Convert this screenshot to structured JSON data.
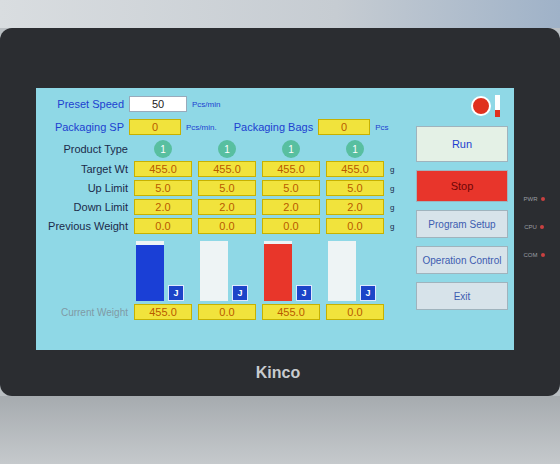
{
  "device": {
    "brand": "Kinco",
    "leds": [
      "PWR",
      "CPU",
      "COM"
    ]
  },
  "preset_speed": {
    "label": "Preset Speed",
    "value": "50",
    "unit": "Pcs/min"
  },
  "packaging_sp": {
    "label": "Packaging SP",
    "value": "0",
    "unit": "Pcs/min."
  },
  "packaging_bags": {
    "label": "Packaging Bags",
    "value": "0",
    "unit": "Pcs"
  },
  "status_lamp": {
    "on": true,
    "color": "#e0301e",
    "level": 0.3
  },
  "product_type": {
    "label": "Product Type",
    "values": [
      "1",
      "1",
      "1",
      "1"
    ]
  },
  "rows": [
    {
      "label": "Target Wt",
      "values": [
        "455.0",
        "455.0",
        "455.0",
        "455.0"
      ],
      "unit": "g"
    },
    {
      "label": "Up Limit",
      "values": [
        "5.0",
        "5.0",
        "5.0",
        "5.0"
      ],
      "unit": "g"
    },
    {
      "label": "Down Limit",
      "values": [
        "2.0",
        "2.0",
        "2.0",
        "2.0"
      ],
      "unit": "g"
    },
    {
      "label": "Previous Weight",
      "values": [
        "0.0",
        "0.0",
        "0.0",
        "0.0"
      ],
      "unit": "g"
    }
  ],
  "lanes": [
    {
      "level": 0.93,
      "color": "#1a3fd6",
      "button": "J",
      "current": "455.0"
    },
    {
      "level": 0,
      "color": "#1a3fd6",
      "button": "J",
      "current": "0.0"
    },
    {
      "level": 0.95,
      "color": "#e8362a",
      "button": "J",
      "current": "455.0"
    },
    {
      "level": 0,
      "color": "#1a3fd6",
      "button": "J",
      "current": "0.0"
    }
  ],
  "current_weight": {
    "label": "Current Weight"
  },
  "buttons": [
    {
      "label": "Run",
      "kind": "run"
    },
    {
      "label": "Stop",
      "kind": "stop"
    },
    {
      "label": "Program Setup",
      "kind": "nav"
    },
    {
      "label": "Operation Control",
      "kind": "nav"
    },
    {
      "label": "Exit",
      "kind": "nav"
    }
  ]
}
